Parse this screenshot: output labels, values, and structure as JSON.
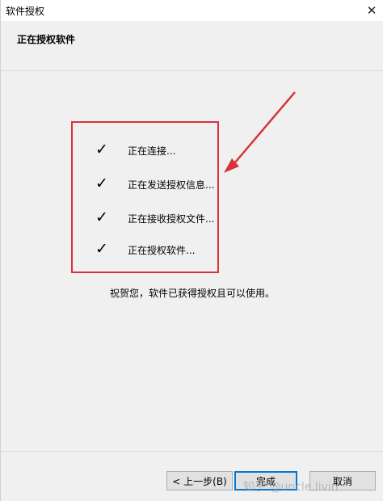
{
  "window": {
    "title": "软件授权",
    "close_label": "✕"
  },
  "header": {
    "title": "正在授权软件"
  },
  "steps": [
    {
      "label": "正在连接..."
    },
    {
      "label": "正在发送授权信息..."
    },
    {
      "label": "正在接收授权文件..."
    },
    {
      "label": "正在授权软件..."
    }
  ],
  "check_glyph": "✓",
  "message": "祝贺您，软件已获得授权且可以使用。",
  "buttons": {
    "back": "< 上一步(B)",
    "finish": "完成",
    "cancel": "取消"
  },
  "watermark": "知乎 @uncle.livin",
  "colors": {
    "highlight": "#d9323a",
    "focus": "#0078d7"
  }
}
